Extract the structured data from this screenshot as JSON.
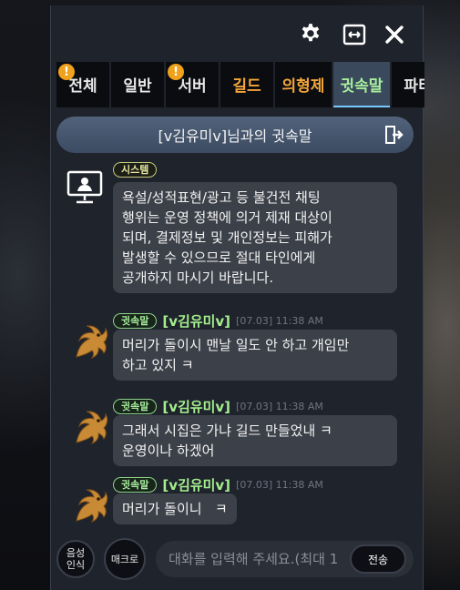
{
  "topbar": {
    "settings_icon": "gear-icon",
    "resize_icon": "resize-horizontal-icon",
    "close_icon": "close-icon"
  },
  "tabs": [
    {
      "label": "전체",
      "badge": "!",
      "color": "#e8e8e8",
      "active": false
    },
    {
      "label": "일반",
      "badge": "",
      "color": "#e8e8e8",
      "active": false
    },
    {
      "label": "서버",
      "badge": "!",
      "color": "#e8e8e8",
      "active": false
    },
    {
      "label": "길드",
      "badge": "",
      "color": "#f4a63a",
      "active": false
    },
    {
      "label": "의형제",
      "badge": "",
      "color": "#f4a63a",
      "active": false
    },
    {
      "label": "귓속말",
      "badge": "",
      "color": "#a8ee9e",
      "active": true
    },
    {
      "label": "파티",
      "badge": "",
      "color": "#e8e8e8",
      "active": false
    }
  ],
  "whisper_bar": {
    "title": "[v김유미v]님과의 귓속말"
  },
  "messages": [
    {
      "type": "system",
      "tag": "시스템",
      "text_lines": [
        "욕설/성적표현/광고 등 불건전 채팅",
        "행위는 운영 정책에 의거 제재 대상이",
        "되며, 결제정보 및 개인정보는 피해가",
        "발생할 수 있으므로 절대 타인에게",
        "공개하지 마시기 바랍니다."
      ]
    },
    {
      "type": "whisper",
      "tag": "귓속말",
      "sender": "[v김유미v]",
      "time": "[07.03] 11:38 AM",
      "text_lines": [
        "머리가 돌이시 맨날 일도 안 하고 개임만",
        "하고 있지 ㅋ"
      ]
    },
    {
      "type": "whisper",
      "tag": "귓속말",
      "sender": "[v김유미v]",
      "time": "[07.03] 11:38 AM",
      "text_lines": [
        "그래서 시집은 가냐 길드 만들었내 ㅋ",
        "운영이나 하겠어"
      ]
    },
    {
      "type": "whisper",
      "tag": "귓속말",
      "sender": "[v김유미v]",
      "time": "[07.03] 11:38 AM",
      "text_lines": [
        "머리가 돌이니   ㅋ"
      ]
    }
  ],
  "bottom": {
    "voice_button": "음성\n인식",
    "macro_button": "매크로",
    "input_placeholder": "대화를 입력해 주세요.(최대 1",
    "send_button": "전송"
  },
  "colors": {
    "accent_active_tab": "#78c8ff",
    "whisper_name": "#a4ee8e",
    "badge": "#f0a21c"
  }
}
